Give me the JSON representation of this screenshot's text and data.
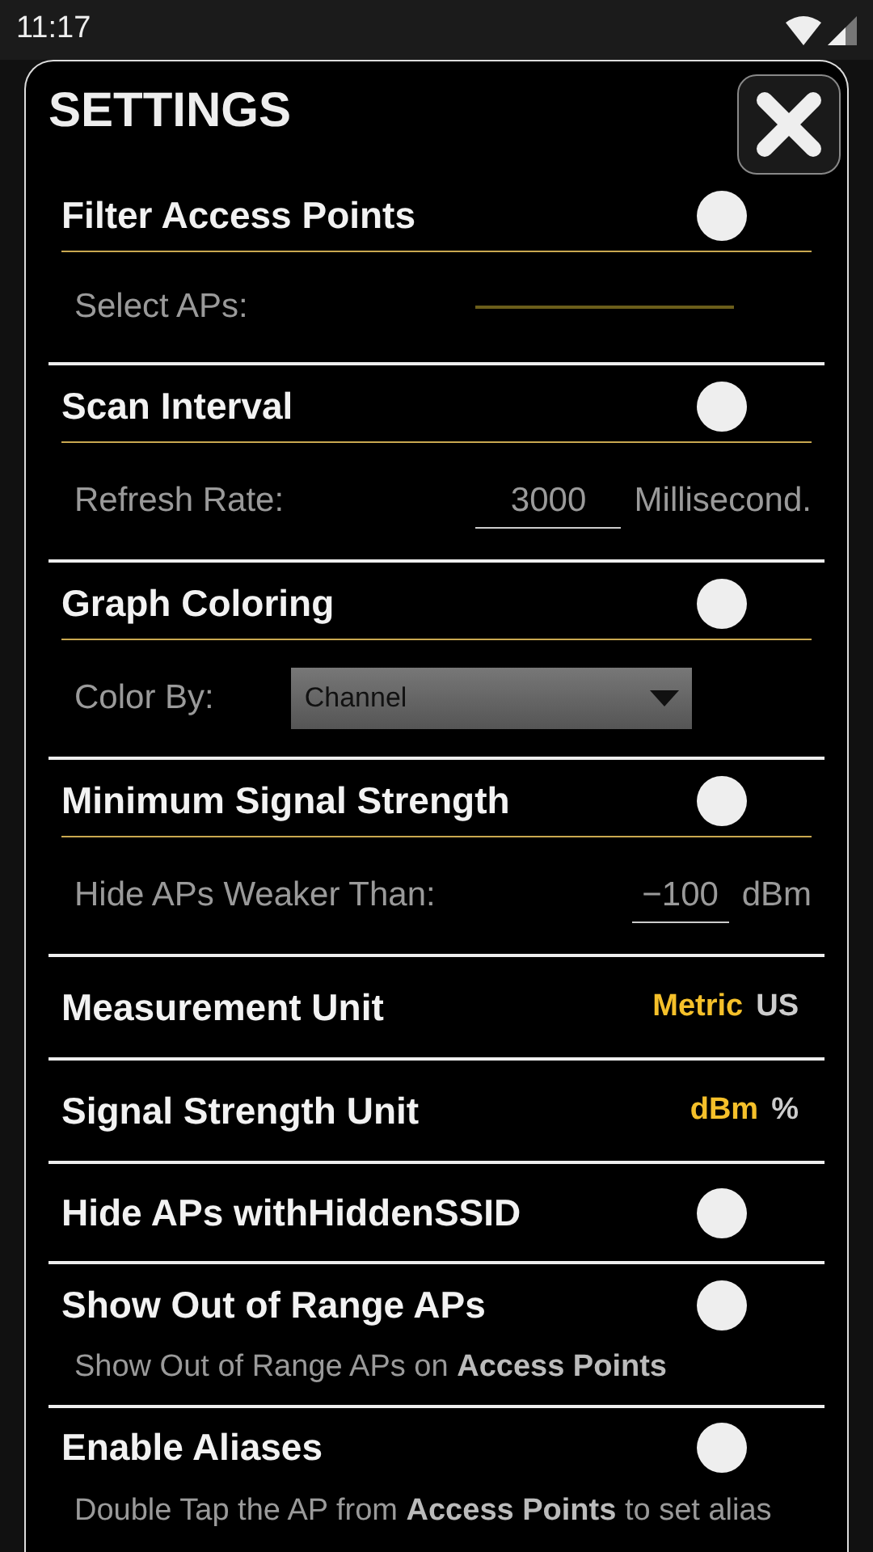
{
  "status_bar": {
    "time": "11:17"
  },
  "dialog": {
    "title": "SETTINGS",
    "settings": [
      {
        "kind": "toggle",
        "title": "Filter Access Points",
        "on": false,
        "detail": {
          "kind": "picker",
          "label": "Select APs:"
        }
      },
      {
        "kind": "toggle",
        "title": "Scan Interval",
        "on": false,
        "detail": {
          "kind": "input",
          "label": "Refresh Rate:",
          "value": "3000",
          "unit": "Millisecond."
        }
      },
      {
        "kind": "toggle",
        "title": "Graph Coloring",
        "on": false,
        "detail": {
          "kind": "dropdown",
          "label": "Color By:",
          "value": "Channel"
        }
      },
      {
        "kind": "toggle",
        "title": "Minimum Signal Strength",
        "on": false,
        "detail": {
          "kind": "input",
          "label": "Hide APs Weaker Than:",
          "value": "−100",
          "unit": "dBm"
        }
      },
      {
        "kind": "choice",
        "title": "Measurement Unit",
        "options": [
          {
            "label": "Metric",
            "selected": true
          },
          {
            "label": "US",
            "selected": false
          }
        ]
      },
      {
        "kind": "choice",
        "title": "Signal Strength Unit",
        "options": [
          {
            "label": "dBm",
            "selected": true
          },
          {
            "label": "%",
            "selected": false
          }
        ]
      },
      {
        "kind": "toggle",
        "title": "Hide APs withHiddenSSID",
        "on": false
      },
      {
        "kind": "toggle",
        "title": "Show Out of Range APs",
        "on": false,
        "note": "Show Out of Range APs on **Access Points**"
      },
      {
        "kind": "toggle",
        "title": "Enable Aliases",
        "on": false,
        "note": "Double Tap the AP from **Access Points** to set alias"
      }
    ]
  }
}
